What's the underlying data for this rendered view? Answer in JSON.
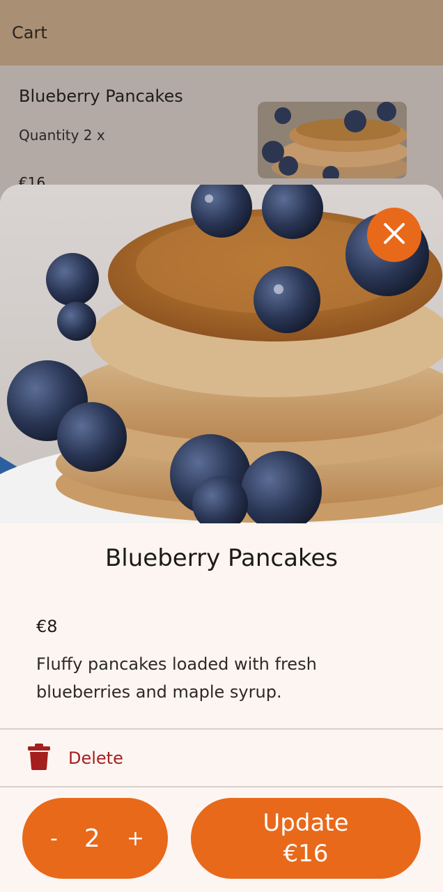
{
  "header": {
    "title": "Cart"
  },
  "cart": {
    "item_name": "Blueberry Pancakes",
    "quantity_text": "Quantity 2 x",
    "price": "€16",
    "thumbnail_icon": "pancakes-photo"
  },
  "sheet": {
    "title": "Blueberry Pancakes",
    "price": "€8",
    "description": "Fluffy pancakes loaded with fresh blueberries and maple syrup.",
    "delete_label": "Delete",
    "stepper": {
      "minus": "-",
      "quantity": "2",
      "plus": "+"
    },
    "update": {
      "label": "Update",
      "total": "€16"
    },
    "close_icon": "close-icon",
    "delete_icon": "trash-icon"
  },
  "colors": {
    "accent": "#e8691a",
    "header_bg": "#a98f73",
    "delete_red": "#a51f1f",
    "sheet_bg": "#fdf5f2"
  }
}
